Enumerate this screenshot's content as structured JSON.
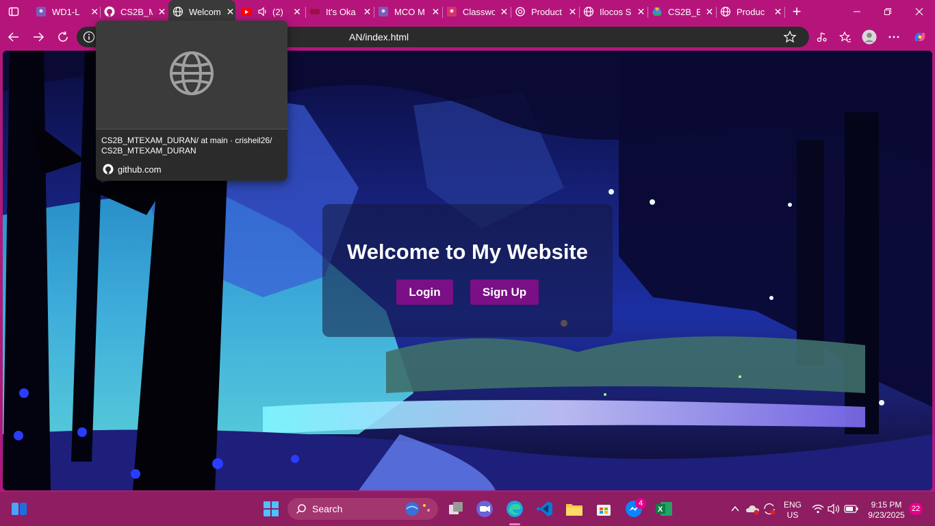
{
  "browser": {
    "tabs": [
      {
        "label": "WD1-L",
        "icon": "classroom-icon",
        "active": false
      },
      {
        "label": "CS2B_M",
        "icon": "github-icon",
        "active": false
      },
      {
        "label": "Welcom",
        "icon": "globe-icon",
        "active": true
      },
      {
        "label": "(2)",
        "icon": "youtube-icon",
        "active": false
      },
      {
        "label": "It's Oka",
        "icon": "page-icon",
        "active": false
      },
      {
        "label": "MCO M",
        "icon": "classroom-icon",
        "active": false
      },
      {
        "label": "Classwo",
        "icon": "classroom-icon",
        "active": false
      },
      {
        "label": "Product",
        "icon": "chatgpt-icon",
        "active": false
      },
      {
        "label": "Ilocos S",
        "icon": "globe-icon",
        "active": false
      },
      {
        "label": "CS2B_E",
        "icon": "drive-icon",
        "active": false
      },
      {
        "label": "Produc",
        "icon": "globe-icon",
        "active": false
      }
    ],
    "tab_close": "✕",
    "new_tab": "+",
    "url": "AN/index.html",
    "hover_card": {
      "title": "CS2B_MTEXAM_DURAN/ at main · crisheil26/ CS2B_MTEXAM_DURAN",
      "domain": "github.com"
    }
  },
  "page": {
    "heading": "Welcome to My Website",
    "login_label": "Login",
    "signup_label": "Sign Up"
  },
  "taskbar": {
    "search_label": "Search",
    "messenger_badge": "4",
    "language": "ENG",
    "region": "US",
    "time": "9:15 PM",
    "date": "9/23/2025",
    "notifications": "22"
  },
  "colors": {
    "browser_chrome": "#b5157b",
    "taskbar": "#8e1d61",
    "button": "#7a0f86"
  }
}
